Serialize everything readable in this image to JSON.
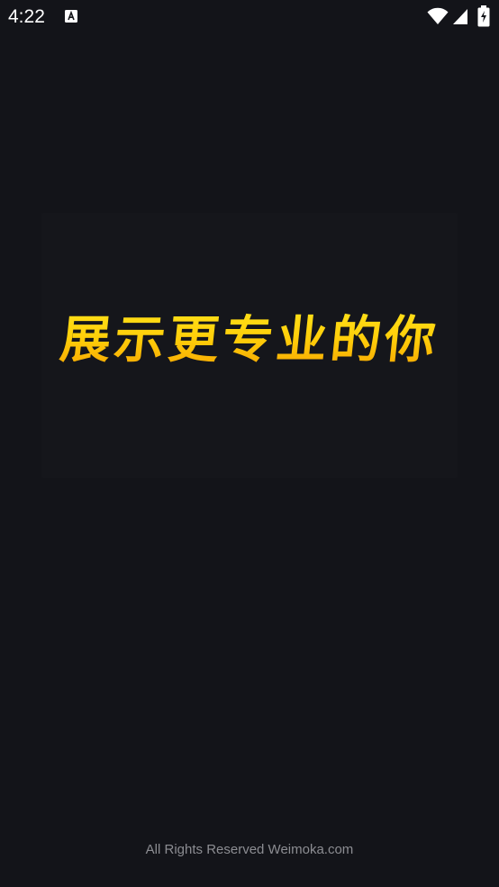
{
  "status_bar": {
    "time": "4:22",
    "notification_icon": "keyboard-a-icon",
    "wifi_icon": "wifi-icon",
    "signal_icon": "cell-signal-icon",
    "battery_icon": "battery-charging-icon"
  },
  "splash": {
    "slogan": "展示更专业的你"
  },
  "footer": {
    "copyright": "All Rights Reserved Weimoka.com"
  },
  "colors": {
    "background": "#131419",
    "slogan_gradient_top": "#ffe21a",
    "slogan_gradient_bottom": "#f5a000",
    "footer_text": "#8c8d92"
  }
}
